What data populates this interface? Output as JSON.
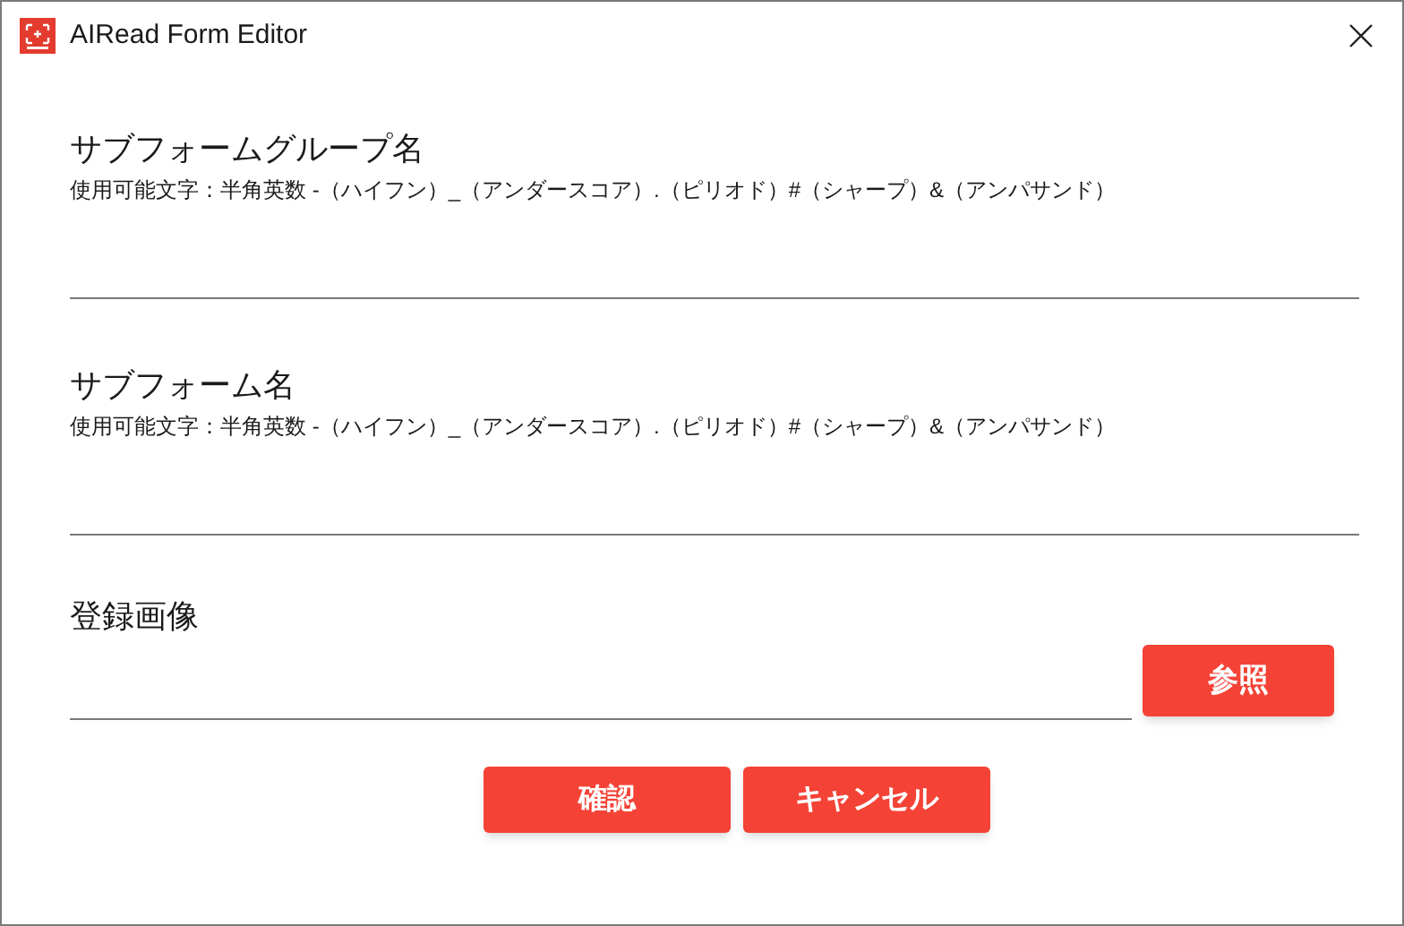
{
  "window": {
    "title": "AIRead Form Editor"
  },
  "fields": [
    {
      "label": "サブフォームグループ名",
      "hint": "使用可能文字：半角英数 -（ハイフン）_（アンダースコア）.（ピリオド）#（シャープ）&（アンパサンド）"
    },
    {
      "label": "サブフォーム名",
      "hint": "使用可能文字：半角英数 -（ハイフン）_（アンダースコア）.（ピリオド）#（シャープ）&（アンパサンド）"
    }
  ],
  "image_field": {
    "label": "登録画像",
    "browse_button": "参照"
  },
  "buttons": [
    "確認",
    "キャンセル"
  ]
}
